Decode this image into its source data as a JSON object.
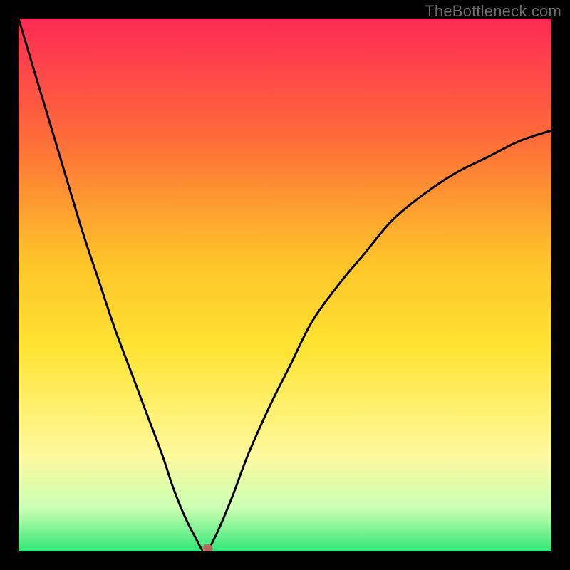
{
  "watermark": "TheBottleneck.com",
  "chart_data": {
    "type": "line",
    "title": "",
    "xlabel": "",
    "ylabel": "",
    "xlim": [
      0,
      100
    ],
    "ylim": [
      0,
      100
    ],
    "grid": false,
    "legend": false,
    "background_gradient": [
      "#ff2a55",
      "#ff6a3a",
      "#ffc229",
      "#ffe433",
      "#fff99e",
      "#c9ffb3",
      "#30e676"
    ],
    "series": [
      {
        "name": "bottleneck-curve",
        "color": "#000000",
        "x": [
          0,
          3,
          6,
          9,
          12,
          15,
          18,
          21,
          24,
          27,
          29,
          31,
          33,
          35,
          37,
          40,
          43,
          47,
          51,
          55,
          60,
          65,
          70,
          76,
          82,
          88,
          94,
          100
        ],
        "y": [
          100,
          90,
          80,
          70,
          60,
          51,
          42,
          34,
          26,
          18,
          12,
          7,
          3,
          0,
          3,
          10,
          18,
          27,
          35,
          43,
          50,
          56,
          62,
          67,
          71,
          74,
          77,
          79
        ]
      }
    ],
    "marker": {
      "x": 35.5,
      "y": 0.5,
      "color": "#b86a5a",
      "radius": 7
    }
  }
}
